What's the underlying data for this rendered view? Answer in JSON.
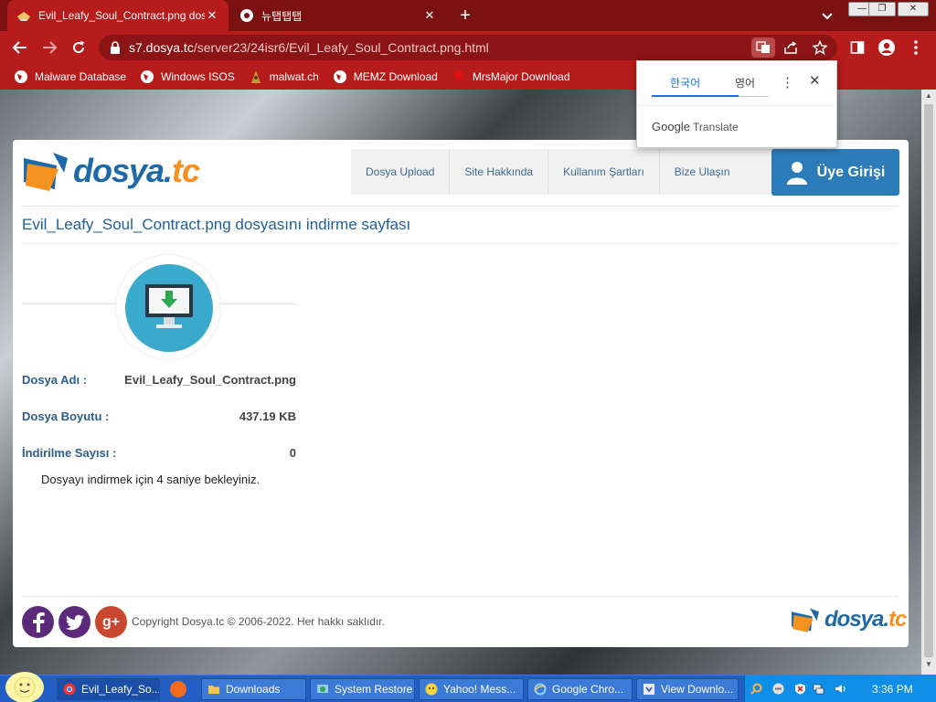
{
  "browser": {
    "tabs": [
      {
        "title": "Evil_Leafy_Soul_Contract.png dos",
        "close": "✕"
      },
      {
        "title": "뉴탭탭탭",
        "close": "✕"
      }
    ],
    "new_tab": "+",
    "url_host": "s7.dosya.tc",
    "url_path": "/server23/24isr6/Evil_Leafy_Soul_Contract.png.html",
    "bookmarks": [
      "Malware Database",
      "Windows ISOS",
      "malwat.ch",
      "MEMZ Download",
      "MrsMajor Download"
    ],
    "window_buttons": {
      "minimize": "—",
      "maximize": "❐",
      "close": "✕"
    }
  },
  "translate_popup": {
    "lang_source": "한국어",
    "lang_target": "영어",
    "more": "⋮",
    "close": "✕",
    "brand": "Google",
    "product": "Translate"
  },
  "site": {
    "logo_main": "dosya.",
    "logo_tc": "tc",
    "nav": [
      "Dosya Upload",
      "Site Hakkında",
      "Kullanım Şartları",
      "Bize Ulaşın"
    ],
    "login": "Üye Girişi",
    "page_title": "Evil_Leafy_Soul_Contract.png dosyasını indirme sayfası",
    "file_name_label": "Dosya Adı :",
    "file_name": "Evil_Leafy_Soul_Contract.png",
    "file_size_label": "Dosya Boyutu :",
    "file_size": "437.19 KB",
    "download_count_label": "İndirilme Sayısı :",
    "download_count": "0",
    "wait_message": "Dosyayı indirmek için 4 saniye bekleyiniz.",
    "copyright": "Copyright Dosya.tc © 2006-2022. Her hakkı saklıdır.",
    "social": [
      "facebook-icon",
      "twitter-icon",
      "google-plus-icon"
    ]
  },
  "taskbar": {
    "items": [
      "Evil_Leafy_So...",
      "Downloads",
      "System Restore",
      "Yahoo! Mess...",
      "Google Chro...",
      "View Downlo..."
    ],
    "clock": "3:36 PM"
  },
  "colors": {
    "chrome_red": "#b61c1c",
    "brand_blue": "#1e69a8",
    "brand_orange": "#f4921f",
    "taskbar_blue": "#235ec4"
  }
}
